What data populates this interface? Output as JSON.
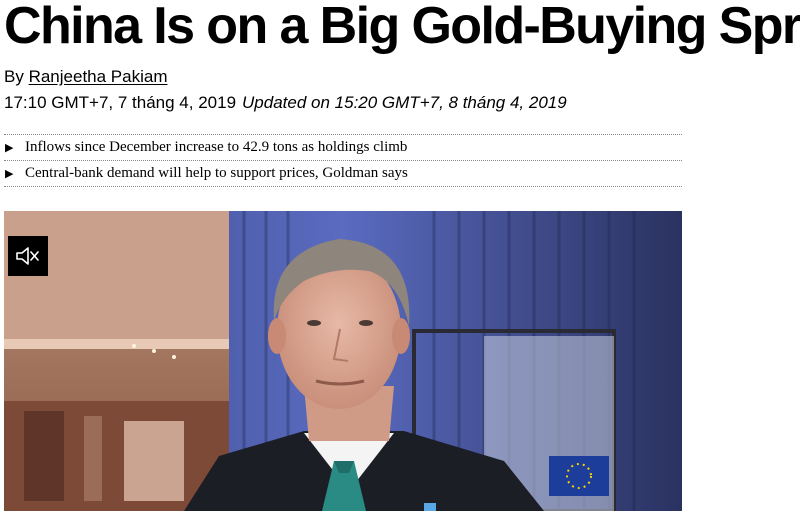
{
  "article": {
    "headline": "China Is on a Big Gold-Buying Spree",
    "byline_prefix": "By",
    "author": "Ranjeetha Pakiam",
    "published": "17:10 GMT+7, 7 tháng 4, 2019",
    "updated": "Updated on 15:20 GMT+7, 8 tháng 4, 2019",
    "bullets": [
      "Inflows since December increase to 42.9 tons as holdings climb",
      "Central-bank demand will help to support prices, Goldman says"
    ]
  },
  "video": {
    "mute_icon": "speaker-muted-icon"
  }
}
